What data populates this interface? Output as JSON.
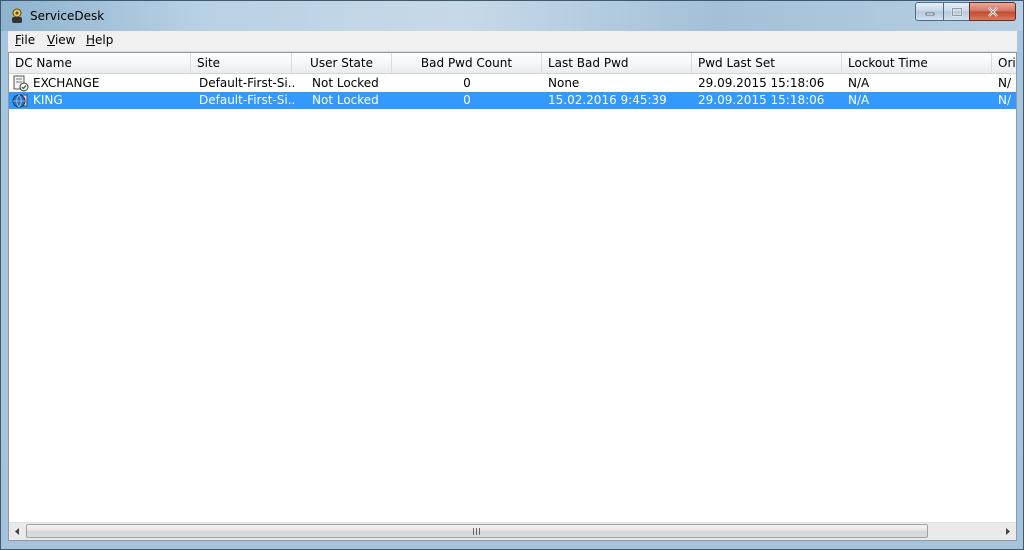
{
  "window": {
    "title": "ServiceDesk"
  },
  "menu": [
    {
      "accel": "F",
      "rest": "ile"
    },
    {
      "accel": "V",
      "rest": "iew"
    },
    {
      "accel": "H",
      "rest": "elp"
    }
  ],
  "table": {
    "columns": [
      "DC Name",
      "Site",
      "User State",
      "Bad Pwd Count",
      "Last Bad Pwd",
      "Pwd Last Set",
      "Lockout Time",
      "Ori"
    ],
    "rows": [
      [
        "EXCHANGE",
        "Default-First-Si...",
        "Not Locked",
        "0",
        "None",
        "29.09.2015 15:18:06",
        "N/A",
        "N/"
      ],
      [
        "KING",
        "Default-First-Si...",
        "Not Locked",
        "0",
        "15.02.2016 9:45:39",
        "29.09.2015 15:18:06",
        "N/A",
        "N/"
      ]
    ],
    "selected_row": 1
  },
  "icons": {
    "app": "key-user-icon",
    "row0": "server-check-icon",
    "row1": "globe-server-icon"
  },
  "colors": {
    "selection": "#3399ff",
    "close_button": "#c24a31"
  }
}
